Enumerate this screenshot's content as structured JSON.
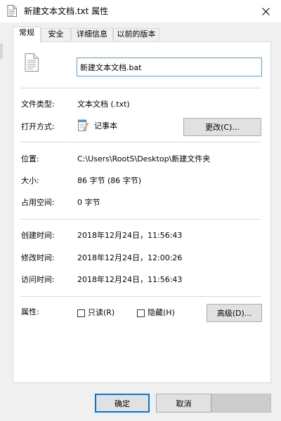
{
  "window": {
    "title": "新建文本文档.txt 属性"
  },
  "tabs": [
    {
      "label": "常规",
      "active": true
    },
    {
      "label": "安全",
      "active": false
    },
    {
      "label": "详细信息",
      "active": false
    },
    {
      "label": "以前的版本",
      "active": false
    }
  ],
  "general": {
    "filename_value": "新建文本文档.bat",
    "file_type_label": "文件类型:",
    "file_type_value": "文本文档 (.txt)",
    "opens_with_label": "打开方式:",
    "opens_with_value": "记事本",
    "change_button": "更改(C)...",
    "location_label": "位置:",
    "location_value": "C:\\Users\\RootS\\Desktop\\新建文件夹",
    "size_label": "大小:",
    "size_value": "86 字节 (86 字节)",
    "size_on_disk_label": "占用空间:",
    "size_on_disk_value": "0 字节",
    "created_label": "创建时间:",
    "created_value": "2018年12月24日，11:56:43",
    "modified_label": "修改时间:",
    "modified_value": "2018年12月24日，12:00:26",
    "accessed_label": "访问时间:",
    "accessed_value": "2018年12月24日，11:56:43",
    "attributes_label": "属性:",
    "readonly_label": "只读(R)",
    "readonly_checked": false,
    "hidden_label": "隐藏(H)",
    "hidden_checked": false,
    "advanced_button": "高级(D)..."
  },
  "footer": {
    "ok_label": "确定",
    "cancel_label": "取消"
  },
  "icons": {
    "title": "document-icon",
    "file": "text-file-icon",
    "opens_with": "notepad-icon",
    "close": "close-icon"
  }
}
